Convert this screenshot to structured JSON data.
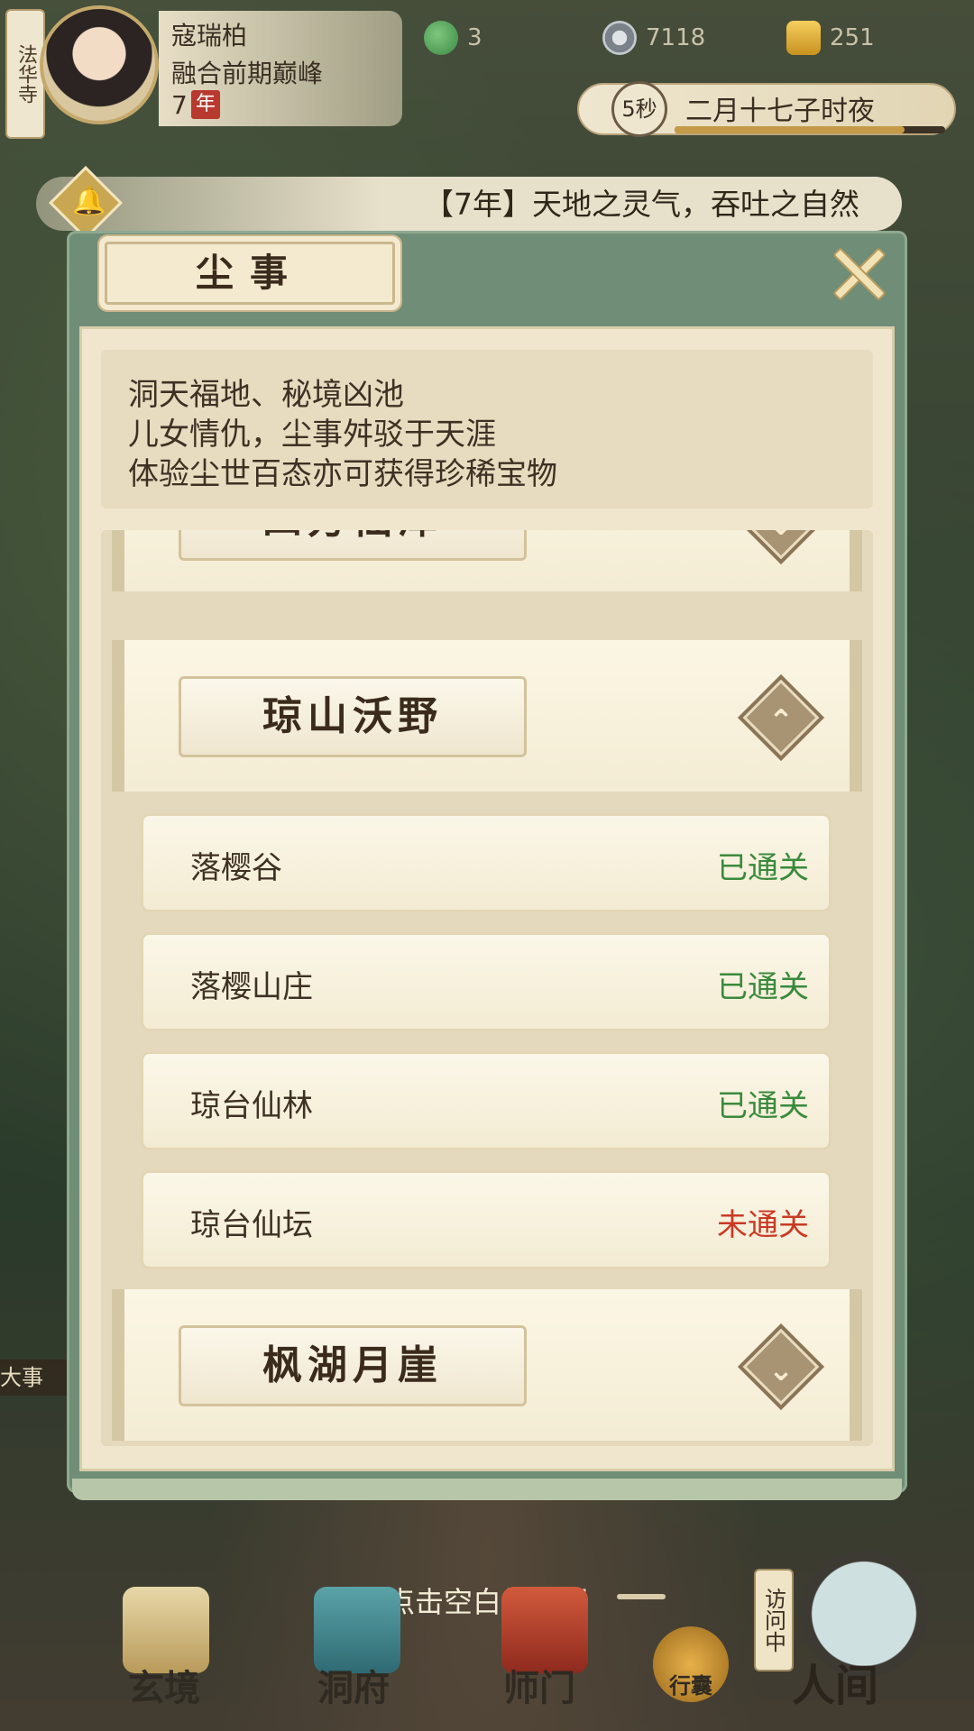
{
  "location": "法华寺",
  "player": {
    "name": "寇瑞柏",
    "realm": "融合前期巅峰",
    "age": "7",
    "age_unit": "年"
  },
  "resources": [
    {
      "icon": "jade-swirl-icon",
      "value": "3",
      "color": "#4aa05a"
    },
    {
      "icon": "coin-icon",
      "value": "7118",
      "color": "#8a8f95"
    },
    {
      "icon": "gold-ingot-icon",
      "value": "251",
      "color": "#d4a02a"
    }
  ],
  "clock": {
    "seconds": "5秒",
    "label": "二月十七子时夜",
    "progress": 0.85
  },
  "announcement": "【7年】天地之灵气，吞吐之自然",
  "modal": {
    "title": "尘事",
    "intro": [
      "洞天福地、秘境凶池",
      "儿女情仇，尘事舛驳于天涯",
      "体验尘世百态亦可获得珍稀宝物"
    ],
    "regions": [
      {
        "name": "四方仙泽",
        "expanded": false
      },
      {
        "name": "琼山沃野",
        "expanded": true
      },
      {
        "name": "枫湖月崖",
        "expanded": false
      }
    ],
    "stages": [
      {
        "name": "落樱谷",
        "status": "已通关",
        "cleared": true
      },
      {
        "name": "落樱山庄",
        "status": "已通关",
        "cleared": true
      },
      {
        "name": "琼台仙林",
        "status": "已通关",
        "cleared": true
      },
      {
        "name": "琼台仙坛",
        "status": "未通关",
        "cleared": false
      }
    ]
  },
  "hint": "点击空白处返回",
  "side_tag": "大事",
  "nav": {
    "items": [
      "玄境",
      "洞府",
      "师门",
      "行囊"
    ],
    "visit_tag": "访问中",
    "world": "人间"
  }
}
